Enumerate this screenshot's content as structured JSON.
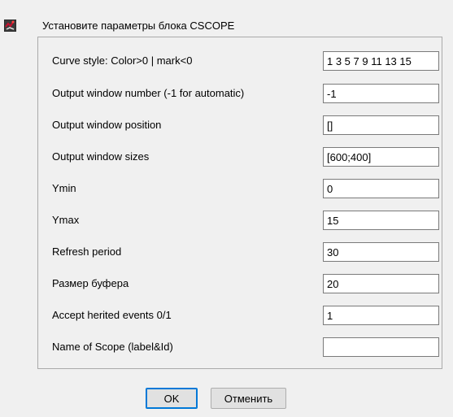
{
  "header": {
    "icon": "scilab-block-icon",
    "title": "Установите параметры блока CSCOPE"
  },
  "params": [
    {
      "label": "Curve style: Color>0 | mark<0",
      "value": "1 3 5 7 9 11 13 15"
    },
    {
      "label": "Output window number (-1 for automatic)",
      "value": "-1"
    },
    {
      "label": "Output window position",
      "value": "[]"
    },
    {
      "label": "Output window sizes",
      "value": "[600;400]"
    },
    {
      "label": "Ymin",
      "value": "0"
    },
    {
      "label": "Ymax",
      "value": "15"
    },
    {
      "label": "Refresh period",
      "value": "30"
    },
    {
      "label": "Размер буфера",
      "value": "20"
    },
    {
      "label": "Accept herited events 0/1",
      "value": "1"
    },
    {
      "label": "Name of Scope (label&Id)",
      "value": ""
    }
  ],
  "buttons": {
    "ok": "OK",
    "cancel": "Отменить"
  },
  "colors": {
    "background": "#f0f0f0",
    "accent": "#0078d7",
    "icon_red": "#c8102e"
  }
}
